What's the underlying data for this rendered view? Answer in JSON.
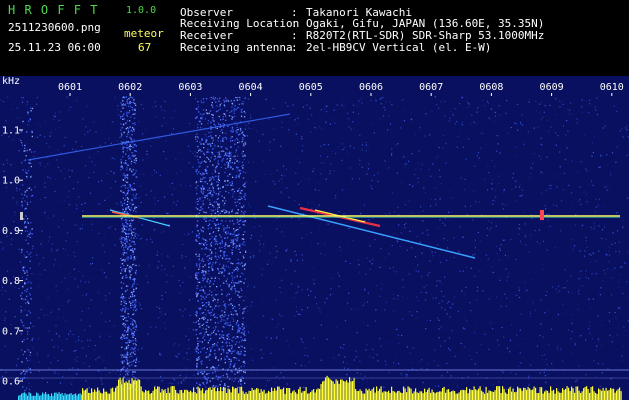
{
  "header": {
    "brand": "H R O F F T",
    "version": "1.0.0",
    "filename": "2511230600.png",
    "datetime": "25.11.23 06:00",
    "meteor_label": "meteor",
    "meteor_count": "67",
    "info": [
      {
        "label": "Observer",
        "sep": ":",
        "value": "Takanori Kawachi"
      },
      {
        "label": "Receiving Location",
        "sep": ":",
        "value": "Ogaki, Gifu, JAPAN (136.60E, 35.35N)"
      },
      {
        "label": "Receiver",
        "sep": ":",
        "value": "R820T2(RTL-SDR) SDR-Sharp 53.1000MHz"
      },
      {
        "label": "Receiving antenna",
        "sep": ":",
        "value": "2el-HB9CV Vertical (el. E-W)"
      }
    ]
  },
  "spectrogram": {
    "unit_label": "kHz",
    "time_labels": [
      "0601",
      "0602",
      "0603",
      "0604",
      "0605",
      "0606",
      "0607",
      "0608",
      "0609",
      "0610"
    ],
    "freq_labels": [
      "1.1",
      "1.0",
      "0.9",
      "0.8",
      "0.7",
      "0.6"
    ],
    "colors": {
      "background": "#0a1060",
      "carrier": "#ffff66",
      "level_bars": "#ffff33",
      "left_bars": "#33ddff",
      "axis_text": "#ffffff"
    }
  }
}
